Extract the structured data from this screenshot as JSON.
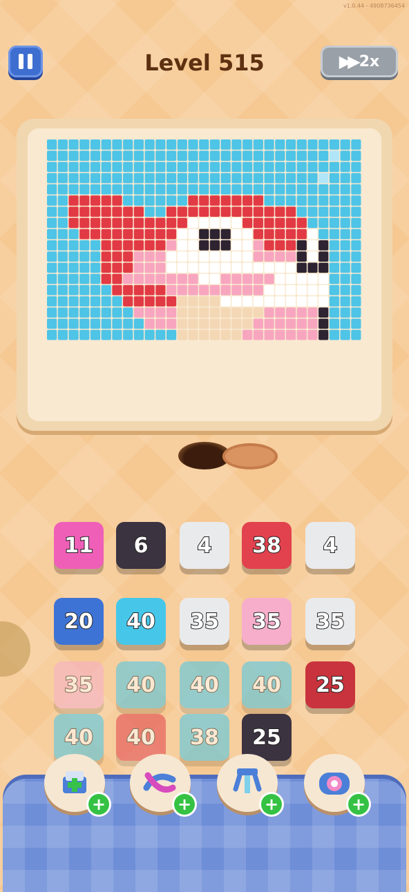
{
  "version": "v1.0.44 - 4908736454",
  "header": {
    "level_title": "Level 515",
    "speed_label": "2x"
  },
  "picture_grid": {
    "cols": 29,
    "rows": 18,
    "colors": {
      "0": "#4ec4e6",
      "1": "#e23a44",
      "2": "#ffffff",
      "3": "#f8a6bf",
      "4": "#2d2331",
      "5": "#b0e6f8",
      "6": "#f4d7b4"
    },
    "rows_data": [
      "00000000000000000000000000000",
      "00000000000000000000000000500",
      "00000000000000000000000000000",
      "00000000000000000000000005000",
      "00000000000000000000000000000",
      "00111110000001111111000000000",
      "00111111100111111111111000000",
      "00111111111112222211111100000",
      "00011111111122444221111120000",
      "00000111111322444223111424000",
      "00000111333222222223333424000",
      "00000111333222222222222444000",
      "00000113333333223333322222000",
      "00000011111333333333222222000",
      "00000001111166662222222222000",
      "00000000333366666666333334000",
      "00000000033366666663333334000",
      "00000000000066666633333334000"
    ]
  },
  "tiles": [
    {
      "value": "11",
      "color": "#ef5fb8",
      "dim": false
    },
    {
      "value": "6",
      "color": "#3b3340",
      "dim": false
    },
    {
      "value": "4",
      "color": "#e9eaec",
      "dim": false
    },
    {
      "value": "38",
      "color": "#e2424e",
      "dim": false
    },
    {
      "value": "4",
      "color": "#e9eaec",
      "dim": false
    },
    {
      "value": "20",
      "color": "#3e73d6",
      "dim": false
    },
    {
      "value": "40",
      "color": "#46c7ea",
      "dim": false
    },
    {
      "value": "35",
      "color": "#e9eaec",
      "dim": false
    },
    {
      "value": "35",
      "color": "#f6aecb",
      "dim": false
    },
    {
      "value": "35",
      "color": "#e9eaec",
      "dim": false
    },
    {
      "value": "35",
      "color": "#f6aecb",
      "dim": true
    },
    {
      "value": "40",
      "color": "#46c7ea",
      "dim": true
    },
    {
      "value": "40",
      "color": "#46c7ea",
      "dim": true
    },
    {
      "value": "40",
      "color": "#46c7ea",
      "dim": true
    },
    {
      "value": "25",
      "color": "#c9333d",
      "dim": false
    },
    {
      "value": "40",
      "color": "#46c7ea",
      "dim": true
    },
    {
      "value": "40",
      "color": "#e2424e",
      "dim": true
    },
    {
      "value": "38",
      "color": "#46c7ea",
      "dim": true
    },
    {
      "value": "25",
      "color": "#3b3340",
      "dim": false
    }
  ],
  "boosters": [
    {
      "icon": "add-slot-icon"
    },
    {
      "icon": "shuffle-icon"
    },
    {
      "icon": "magnet-icon"
    },
    {
      "icon": "vacuum-icon"
    }
  ]
}
